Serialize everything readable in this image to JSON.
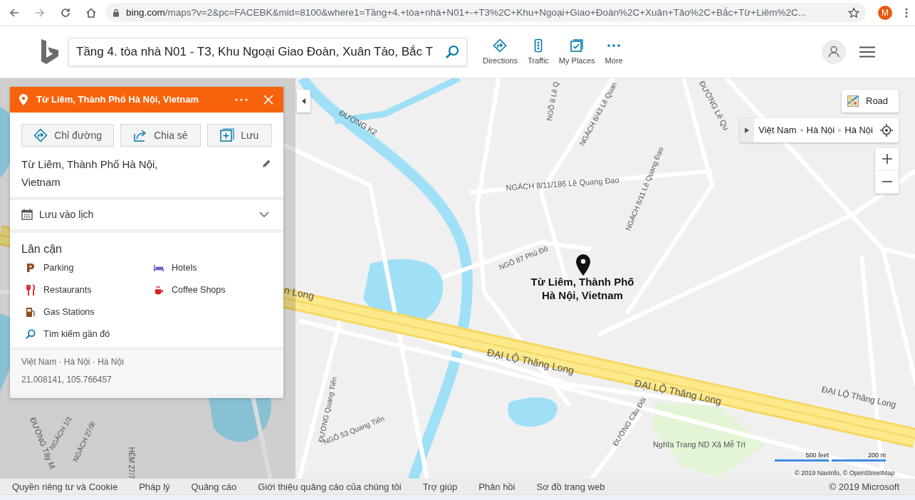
{
  "browser": {
    "url_host": "bing.com",
    "url_rest": "/maps?v=2&pc=FACEBK&mid=8100&where1=Tầng+4.+tòa+nhà+N01+-+T3%2C+Khu+Ngoại+Giao+Đoàn%2C+Xuân+Tảo%2C+Bắc+Từ+Liêm%2C...",
    "profile_initial": "M"
  },
  "header": {
    "search_value": "Tầng 4. tòa nhà N01 - T3, Khu Ngoại Giao Đoàn, Xuân Tảo, Bắc T",
    "nav": [
      {
        "label": "Directions",
        "kind": "directions"
      },
      {
        "label": "Traffic",
        "kind": "traffic"
      },
      {
        "label": "My Places",
        "kind": "places"
      },
      {
        "label": "More",
        "kind": "more"
      }
    ]
  },
  "place_panel": {
    "title": "Từ Liêm, Thành Phố Hà Nội, Vietnam",
    "actions": [
      {
        "label": "Chỉ đường",
        "kind": "directions"
      },
      {
        "label": "Chia sẻ",
        "kind": "share"
      },
      {
        "label": "Lưu",
        "kind": "save"
      }
    ],
    "address": "Từ Liêm, Thành Phố Hà Nội, Vietnam",
    "calendar_label": "Lưu vào lịch",
    "expanded": false,
    "nearby_title": "Lân cận",
    "nearby": [
      {
        "label": "Parking",
        "kind": "parking"
      },
      {
        "label": "Hotels",
        "kind": "hotels"
      },
      {
        "label": "Restaurants",
        "kind": "restaurants"
      },
      {
        "label": "Coffee Shops",
        "kind": "coffee"
      },
      {
        "label": "Gas Stations",
        "kind": "gas"
      },
      {
        "label": "Tìm kiếm gần đó",
        "kind": "search"
      }
    ],
    "breadcrumb": "Việt Nam · Hà Nội · Hà Nội",
    "coordinates": "21.008141, 105.766457"
  },
  "map": {
    "pin_label": "Từ Liêm, Thành Phố Hà Nội, Vietnam",
    "road_button": "Road",
    "breadcrumb": [
      "Việt Nam",
      "Hà Nội",
      "Hà Nội"
    ],
    "scale": [
      "500 feet",
      "200 m"
    ],
    "attribution": "© 2019 NavInfo, © OpenStreetMap",
    "labels": [
      "ĐƯỜNG K2",
      "NGÕ 8 Lê Q",
      "NGÁCH 8/43 Lê Quan",
      "NGÁCH 8/11/186 Lê Quang Đạo",
      "NGÁCH 8/11 Lê Quang Đạo",
      "ĐƯỜNG Lê Qu",
      "NGÕ 87 Phú Đô",
      "n Long",
      "ĐẠI LỘ Thăng Long",
      "ĐẠI LỘ Thăng Long",
      "ĐẠI LỘ Thăng Long",
      "ĐƯỜNG Quang Tiến",
      "NGÕ 53 Quang Tiến",
      "ĐƯỜNG Cầu Đòi",
      "Nghĩa Trang ND Xã Mễ Trì",
      "NGÁCH 1/1",
      "NGÁCH 27/9/",
      "ĐƯỜNG Tây M",
      "HẺM 27/7"
    ]
  },
  "footer": {
    "links": [
      "Quyền riêng tư và Cookie",
      "Pháp lý",
      "Quảng cáo",
      "Giới thiệu quảng cáo của chúng tôi",
      "Trợ giúp",
      "Phản hồi",
      "Sơ đồ trang web"
    ],
    "copyright": "© 2019 Microsoft"
  }
}
